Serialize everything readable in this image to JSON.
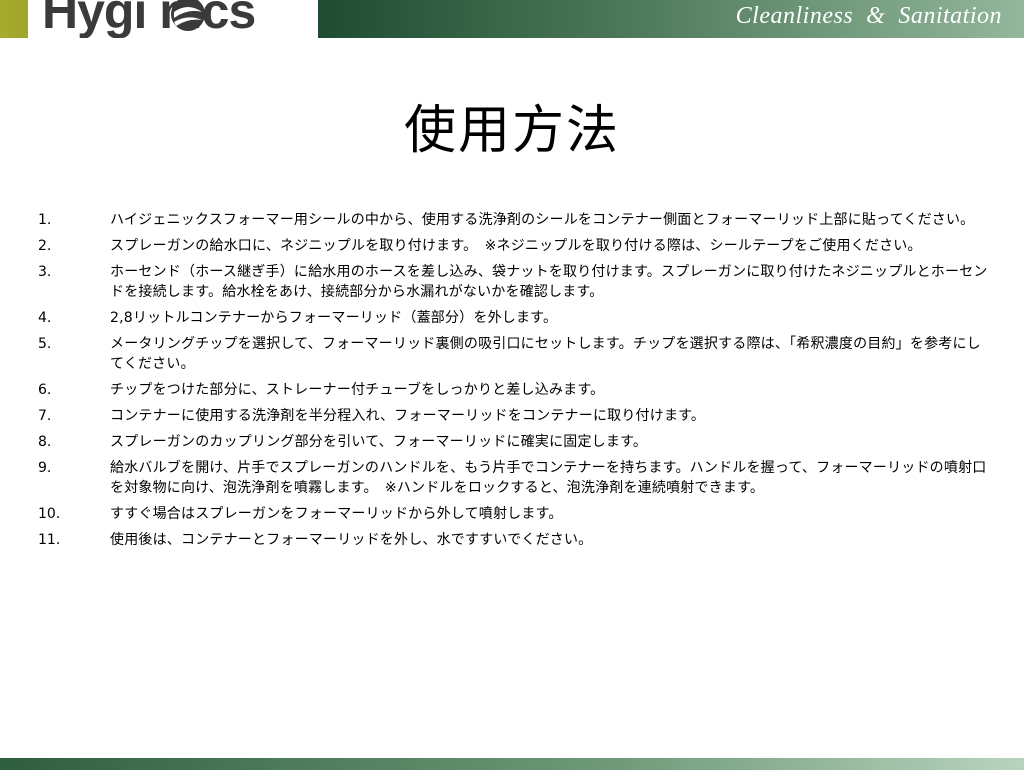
{
  "header": {
    "logo_text": "Hygi  nics",
    "logo_reg": "®",
    "tagline": "Cleanliness  &  Sanitation"
  },
  "page_title": "使用方法",
  "steps": [
    {
      "num": "1.",
      "text": "ハイジェニックスフォーマー用シールの中から、使用する洗浄剤のシールをコンテナー側面とフォーマーリッド上部に貼ってください。"
    },
    {
      "num": "2.",
      "text": "スプレーガンの給水口に、ネジニップルを取り付けます。　※ネジニップルを取り付ける際は、シールテープをご使用ください。"
    },
    {
      "num": "3.",
      "text": "ホーセンド（ホース継ぎ手）に給水用のホースを差し込み、袋ナットを取り付けます。スプレーガンに取り付けたネジニップルとホーセンドを接続します。給水栓をあけ、接続部分から水漏れがないかを確認します。"
    },
    {
      "num": "4.",
      "text": "2,8リットルコンテナーからフォーマーリッド（蓋部分）を外します。"
    },
    {
      "num": "5.",
      "text": "メータリングチップを選択して、フォーマーリッド裏側の吸引口にセットします。チップを選択する際は、「希釈濃度の目約」を参考にしてください。"
    },
    {
      "num": "6.",
      "text": "チップをつけた部分に、ストレーナー付チューブをしっかりと差し込みます。"
    },
    {
      "num": "7.",
      "text": "コンテナーに使用する洗浄剤を半分程入れ、フォーマーリッドをコンテナーに取り付けます。"
    },
    {
      "num": "8.",
      "text": "スプレーガンのカップリング部分を引いて、フォーマーリッドに確実に固定します。"
    },
    {
      "num": "9.",
      "text": "給水バルブを開け、片手でスプレーガンのハンドルを、もう片手でコンテナーを持ちます。ハンドルを握って、フォーマーリッドの噴射口を対象物に向け、泡洗浄剤を噴霧します。　※ハンドルをロックすると、泡洗浄剤を連続噴射できます。"
    },
    {
      "num": "10.",
      "text": "すすぐ場合はスプレーガンをフォーマーリッドから外して噴射します。"
    },
    {
      "num": "11.",
      "text": "使用後は、コンテナーとフォーマーリッドを外し、水ですすいでください。"
    }
  ]
}
